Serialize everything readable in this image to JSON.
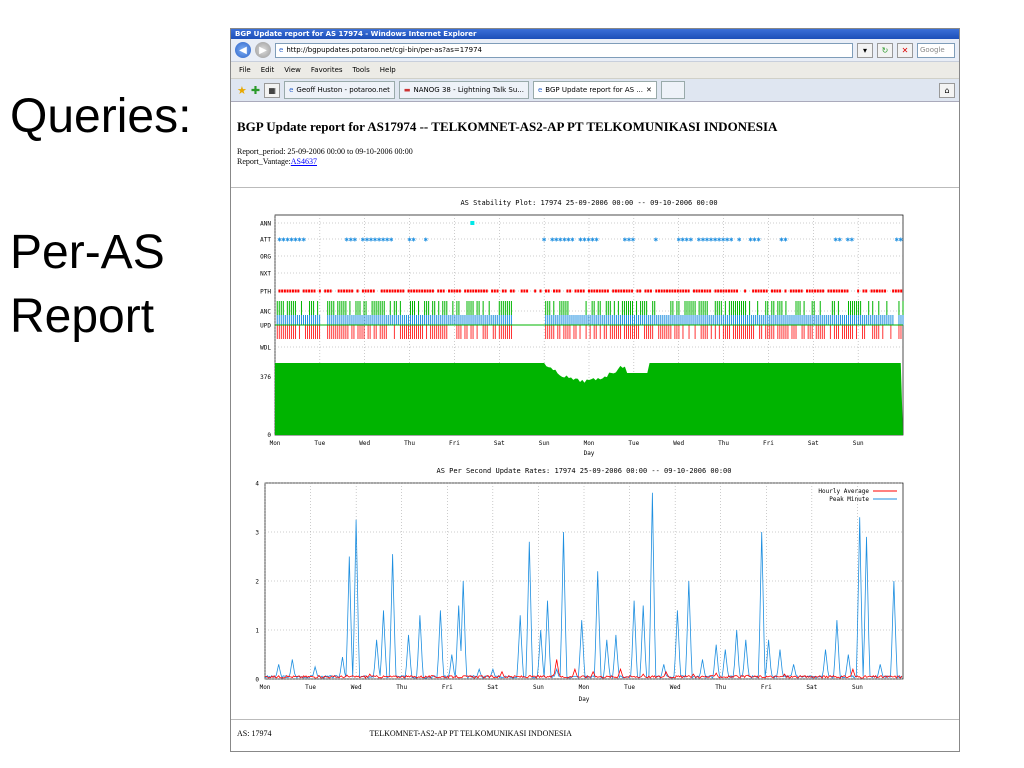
{
  "slide": {
    "heading": "Queries:",
    "sub1": "Per-AS",
    "sub2": "Report"
  },
  "window": {
    "title": "BGP Update report for AS 17974 - Windows Internet Explorer"
  },
  "address": {
    "url": "http://bgpupdates.potaroo.net/cgi-bin/per-as?as=17974",
    "search_placeholder": "Google"
  },
  "menu": [
    "File",
    "Edit",
    "View",
    "Favorites",
    "Tools",
    "Help"
  ],
  "tabs": [
    "Geoff Huston - potaroo.net",
    "NANOG 38 - Lightning Talk Su...",
    "BGP Update report for AS ..."
  ],
  "page": {
    "title": "BGP Update report for AS17974 -- TELKOMNET-AS2-AP PT TELKOMUNIKASI INDONESIA",
    "report_period": "Report_period: 25-09-2006 00:00 to 09-10-2006 00:00",
    "vantage_label": "Report_Vantage:",
    "vantage_link": "AS4637",
    "footer_as": "AS: 17974",
    "footer_name": "TELKOMNET-AS2-AP PT TELKOMUNIKASI INDONESIA"
  },
  "colors": {
    "green": "#00b400",
    "blue": "#1e8fe0",
    "red": "#ff0000",
    "cyan": "#00e8e8"
  },
  "chart_data": [
    {
      "type": "scatter",
      "title": "AS Stability Plot: 17974  25-09-2006 00:00 -- 09-10-2006 00:00",
      "xlabel": "Day",
      "x_ticks": [
        "Mon",
        "Tue",
        "Wed",
        "Thu",
        "Fri",
        "Sat",
        "Sun",
        "Mon",
        "Tue",
        "Wed",
        "Thu",
        "Fri",
        "Sat",
        "Sun"
      ],
      "y_rows": [
        "ANN",
        "ATT",
        "ORG",
        "NXT",
        "PTH",
        "ANC",
        "UPD",
        "WDL"
      ],
      "y_ticks": [
        "376",
        "0"
      ],
      "green_area_level": 376,
      "ann_point_day": 4.4
    },
    {
      "type": "line",
      "title": "AS Per Second Update Rates: 17974  25-09-2006 00:00 -- 09-10-2006 00:00",
      "xlabel": "Day",
      "x_ticks": [
        "Mon",
        "Tue",
        "Wed",
        "Thu",
        "Fri",
        "Sat",
        "Sun",
        "Mon",
        "Tue",
        "Wed",
        "Thu",
        "Fri",
        "Sat",
        "Sun"
      ],
      "ylim": [
        0,
        4
      ],
      "y_ticks": [
        "0",
        "1",
        "2",
        "3",
        "4"
      ],
      "legend": "top-right",
      "series": [
        {
          "name": "Hourly Average",
          "color": "#ff0000",
          "peaks": [
            [
              0.5,
              0.05
            ],
            [
              1.8,
              0.08
            ],
            [
              2.3,
              0.1
            ],
            [
              3.0,
              0.05
            ],
            [
              4.2,
              0.05
            ],
            [
              5.2,
              0.15
            ],
            [
              6.4,
              0.4
            ],
            [
              6.8,
              0.2
            ],
            [
              7.2,
              0.15
            ],
            [
              7.8,
              0.2
            ],
            [
              8.3,
              0.1
            ],
            [
              8.8,
              0.15
            ],
            [
              9.4,
              0.1
            ],
            [
              9.9,
              0.12
            ],
            [
              10.6,
              0.08
            ],
            [
              11.4,
              0.1
            ],
            [
              11.8,
              0.05
            ],
            [
              12.4,
              0.05
            ],
            [
              12.9,
              0.2
            ],
            [
              13.3,
              0.05
            ]
          ]
        },
        {
          "name": "Peak Minute",
          "color": "#1e8fe0",
          "peaks": [
            [
              0.3,
              0.3
            ],
            [
              0.6,
              0.4
            ],
            [
              1.1,
              0.25
            ],
            [
              1.7,
              0.45
            ],
            [
              1.85,
              2.5
            ],
            [
              2.0,
              3.25
            ],
            [
              2.45,
              0.8
            ],
            [
              2.6,
              1.4
            ],
            [
              2.8,
              2.55
            ],
            [
              3.15,
              0.9
            ],
            [
              3.4,
              1.3
            ],
            [
              3.85,
              1.4
            ],
            [
              4.1,
              0.5
            ],
            [
              4.25,
              1.5
            ],
            [
              4.35,
              2.0
            ],
            [
              4.7,
              0.2
            ],
            [
              5.0,
              0.2
            ],
            [
              5.6,
              1.3
            ],
            [
              5.8,
              2.8
            ],
            [
              6.05,
              1.0
            ],
            [
              6.2,
              1.6
            ],
            [
              6.4,
              0.2
            ],
            [
              6.55,
              3.0
            ],
            [
              6.95,
              1.2
            ],
            [
              7.3,
              2.2
            ],
            [
              7.5,
              0.8
            ],
            [
              7.7,
              0.9
            ],
            [
              8.1,
              1.6
            ],
            [
              8.3,
              1.5
            ],
            [
              8.5,
              3.8
            ],
            [
              8.75,
              0.3
            ],
            [
              9.05,
              1.4
            ],
            [
              9.3,
              2.0
            ],
            [
              9.6,
              0.4
            ],
            [
              9.9,
              0.7
            ],
            [
              10.1,
              0.6
            ],
            [
              10.35,
              1.0
            ],
            [
              10.55,
              0.8
            ],
            [
              10.9,
              3.0
            ],
            [
              11.05,
              0.8
            ],
            [
              11.3,
              0.6
            ],
            [
              11.6,
              0.3
            ],
            [
              12.3,
              0.6
            ],
            [
              12.55,
              1.2
            ],
            [
              12.8,
              0.5
            ],
            [
              13.05,
              3.3
            ],
            [
              13.2,
              2.9
            ],
            [
              13.5,
              0.3
            ],
            [
              13.8,
              2.0
            ]
          ]
        }
      ]
    }
  ]
}
